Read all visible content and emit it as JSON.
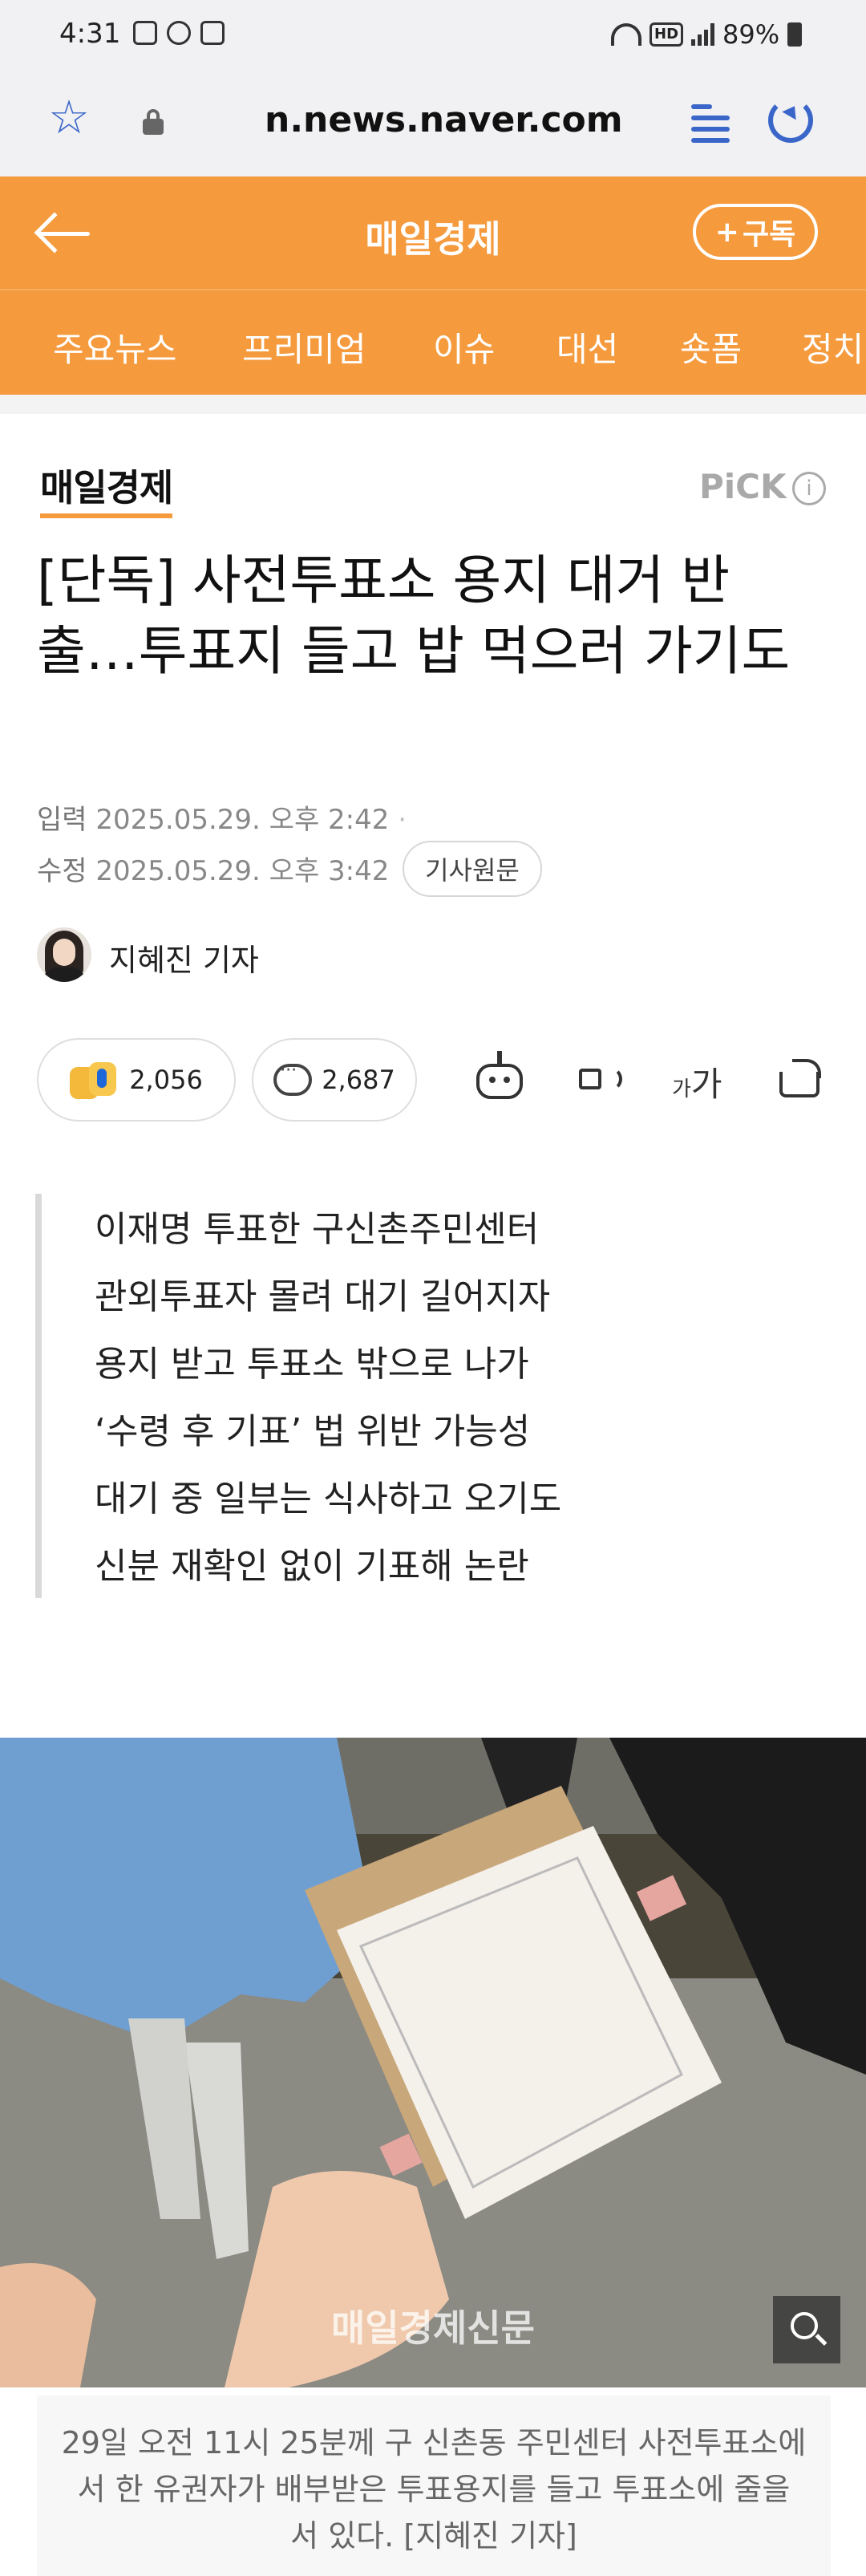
{
  "status_bar": {
    "time": "4:31",
    "battery": "89%",
    "hd_badge": "HD"
  },
  "browser": {
    "url": "n.news.naver.com"
  },
  "header": {
    "brand": "매일경제",
    "subscribe_label": "구독"
  },
  "nav": {
    "items": [
      "주요뉴스",
      "프리미엄",
      "이슈",
      "대선",
      "숏폼",
      "정치"
    ]
  },
  "article": {
    "publisher_logo": "매일경제",
    "pick_label": "PiCK",
    "info_symbol": "i",
    "headline": "[단독] 사전투표소 용지 대거 반출…투표지 들고 밥 먹으러 가기도",
    "input_label": "입력",
    "input_date": "2025.05.29. 오후 2:42",
    "modified_label": "수정",
    "modified_date": "2025.05.29. 오후 3:42",
    "original_button": "기사원문",
    "reporter": "지혜진 기자",
    "reaction_count": "2,056",
    "comment_count": "2,687",
    "font_small": "가",
    "font_large": "가",
    "summary": [
      "이재명 투표한 구신촌주민센터",
      "관외투표자 몰려 대기 길어지자",
      "용지 받고 투표소 밖으로 나가",
      "‘수령 후 기표’ 법 위반 가능성",
      "대기 중 일부는 식사하고 오기도",
      "신분 재확인 없이 기표해 논란"
    ],
    "photo_watermark": "매일경제신문",
    "caption": "29일 오전 11시 25분께 구 신촌동 주민센터 사전투표소에서 한 유권자가 배부받은 투표용지를 들고 투표소에 줄을 서 있다. [지혜진 기자]"
  },
  "colors": {
    "brand_orange": "#f59a3d",
    "link_blue": "#3a66c9"
  }
}
